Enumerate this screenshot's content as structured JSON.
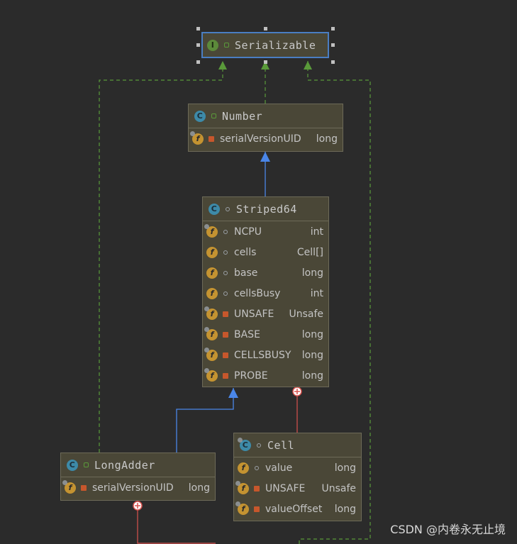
{
  "nodes": {
    "serializable": {
      "name": "Serializable",
      "icon": "interface-icon"
    },
    "number": {
      "name": "Number",
      "icon": "class-icon",
      "fields": [
        {
          "name": "serialVersionUID",
          "type": "long"
        }
      ]
    },
    "striped64": {
      "name": "Striped64",
      "icon": "abstract-class-icon",
      "fields": [
        {
          "name": "NCPU",
          "type": "int"
        },
        {
          "name": "cells",
          "type": "Cell[]"
        },
        {
          "name": "base",
          "type": "long"
        },
        {
          "name": "cellsBusy",
          "type": "int"
        },
        {
          "name": "UNSAFE",
          "type": "Unsafe"
        },
        {
          "name": "BASE",
          "type": "long"
        },
        {
          "name": "CELLSBUSY",
          "type": "long"
        },
        {
          "name": "PROBE",
          "type": "long"
        }
      ]
    },
    "longadder": {
      "name": "LongAdder",
      "icon": "class-icon",
      "fields": [
        {
          "name": "serialVersionUID",
          "type": "long"
        }
      ]
    },
    "cell": {
      "name": "Cell",
      "icon": "class-icon",
      "fields": [
        {
          "name": "value",
          "type": "long"
        },
        {
          "name": "UNSAFE",
          "type": "Unsafe"
        },
        {
          "name": "valueOffset",
          "type": "long"
        }
      ]
    }
  },
  "icons": {
    "class_letter": "C",
    "interface_letter": "I",
    "field_letter": "f"
  },
  "colors": {
    "background": "#2b2b2b",
    "node_fill": "#4a4737",
    "extends_arrow": "#4a86e8",
    "implements_arrow": "#5a9a3a",
    "inner_class_link": "#d9534f",
    "selection": "#4a7ec2"
  },
  "watermark": "CSDN @内卷永无止境"
}
